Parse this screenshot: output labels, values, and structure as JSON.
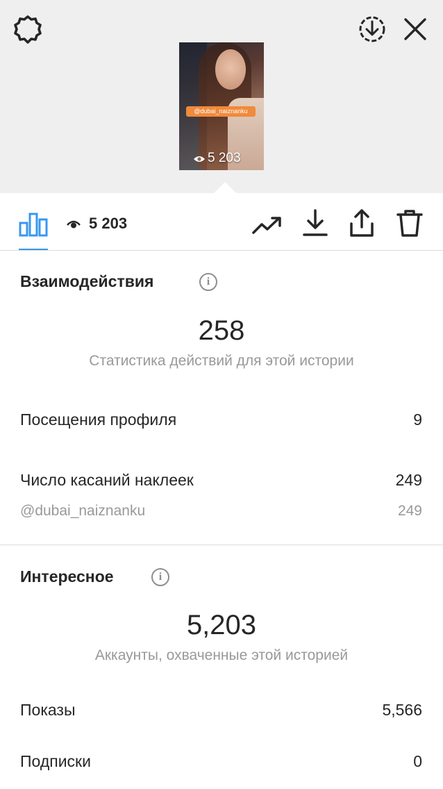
{
  "header": {
    "settings_icon": "gear-icon",
    "save_icon": "download-circle-icon",
    "close_icon": "close-icon"
  },
  "story": {
    "mention_tag": "@dubai_naiznanku",
    "views": "5 203"
  },
  "toolbar": {
    "views": "5 203",
    "icons": [
      "bar-chart-icon",
      "eye-icon",
      "trending-icon",
      "download-icon",
      "share-icon",
      "trash-icon"
    ]
  },
  "interactions": {
    "title": "Взаимодействия",
    "total": "258",
    "caption": "Статистика действий для этой истории",
    "rows": [
      {
        "label": "Посещения профиля",
        "value": "9"
      },
      {
        "label": "Число касаний наклеек",
        "value": "249"
      }
    ],
    "sub_row": {
      "label": "@dubai_naiznanku",
      "value": "249"
    }
  },
  "discovery": {
    "title": "Интересное",
    "total": "5,203",
    "caption": "Аккаунты, охваченные этой историей",
    "rows": [
      {
        "label": "Показы",
        "value": "5,566"
      },
      {
        "label": "Подписки",
        "value": "0"
      }
    ]
  },
  "colors": {
    "accent": "#3897f0",
    "sticker": "#f08a3c",
    "muted": "#999999"
  }
}
